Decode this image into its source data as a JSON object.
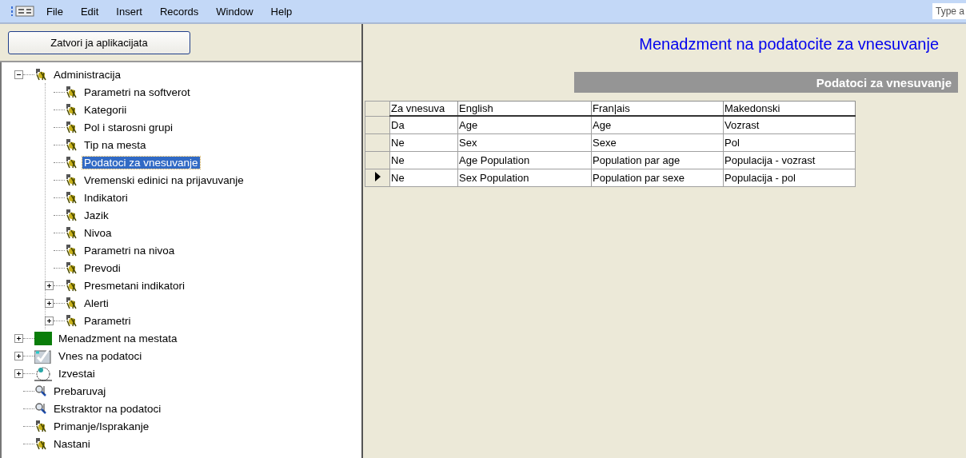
{
  "menu": {
    "items": [
      "File",
      "Edit",
      "Insert",
      "Records",
      "Window",
      "Help"
    ],
    "help_search": {
      "placeholder": "Type a"
    }
  },
  "sidebar": {
    "close_button": "Zatvori ja aplikacijata",
    "tree": [
      {
        "label": "Administracija",
        "kind": "tool",
        "expanded": true,
        "selected": false,
        "children": [
          {
            "label": "Parametri na softverot",
            "kind": "tool",
            "selected": false
          },
          {
            "label": "Kategorii",
            "kind": "tool",
            "selected": false
          },
          {
            "label": "Pol i starosni grupi",
            "kind": "tool",
            "selected": false
          },
          {
            "label": "Tip na mesta",
            "kind": "tool",
            "selected": false
          },
          {
            "label": "Podatoci za vnesuvanje",
            "kind": "tool",
            "selected": true
          },
          {
            "label": "Vremenski edinici na prijavuvanje",
            "kind": "tool",
            "selected": false
          },
          {
            "label": "Indikatori",
            "kind": "tool",
            "selected": false
          },
          {
            "label": "Jazik",
            "kind": "tool",
            "selected": false
          },
          {
            "label": "Nivoa",
            "kind": "tool",
            "selected": false
          },
          {
            "label": "Parametri na nivoa",
            "kind": "tool",
            "selected": false
          },
          {
            "label": "Prevodi",
            "kind": "tool",
            "selected": false
          },
          {
            "label": "Presmetani indikatori",
            "kind": "tool",
            "expanded": false,
            "selected": false
          },
          {
            "label": "Alerti",
            "kind": "tool",
            "expanded": false,
            "selected": false
          },
          {
            "label": "Parametri",
            "kind": "tool",
            "expanded": false,
            "selected": false
          }
        ]
      },
      {
        "label": "Menadzment na mestata",
        "kind": "folder",
        "expanded": false,
        "selected": false
      },
      {
        "label": "Vnes na podatoci",
        "kind": "checklist",
        "expanded": false,
        "selected": false
      },
      {
        "label": "Izvestai",
        "kind": "report",
        "expanded": false,
        "selected": false
      },
      {
        "label": "Prebaruvaj",
        "kind": "search",
        "selected": false
      },
      {
        "label": "Ekstraktor na podatoci",
        "kind": "search",
        "selected": false
      },
      {
        "label": "Primanje/Isprakanje",
        "kind": "tool",
        "selected": false
      },
      {
        "label": "Nastani",
        "kind": "tool",
        "selected": false
      }
    ]
  },
  "main": {
    "title": "Menadzment na podatocite za vnesuvanje",
    "section_header": "Podatoci za vnesuvanje",
    "table": {
      "columns": [
        "Za vnesuva",
        "English",
        "Fran|ais",
        "Makedonski"
      ],
      "rows": [
        {
          "cells": [
            "Da",
            "Age",
            "Age",
            "Vozrast"
          ],
          "current": false
        },
        {
          "cells": [
            "Ne",
            "Sex",
            "Sexe",
            "Pol"
          ],
          "current": false
        },
        {
          "cells": [
            "Ne",
            "Age Population",
            "Population par age",
            "Populacija - vozrast"
          ],
          "current": false
        },
        {
          "cells": [
            "Ne",
            "Sex Population",
            "Population par sexe",
            "Populacija - pol"
          ],
          "current": true
        }
      ]
    }
  }
}
